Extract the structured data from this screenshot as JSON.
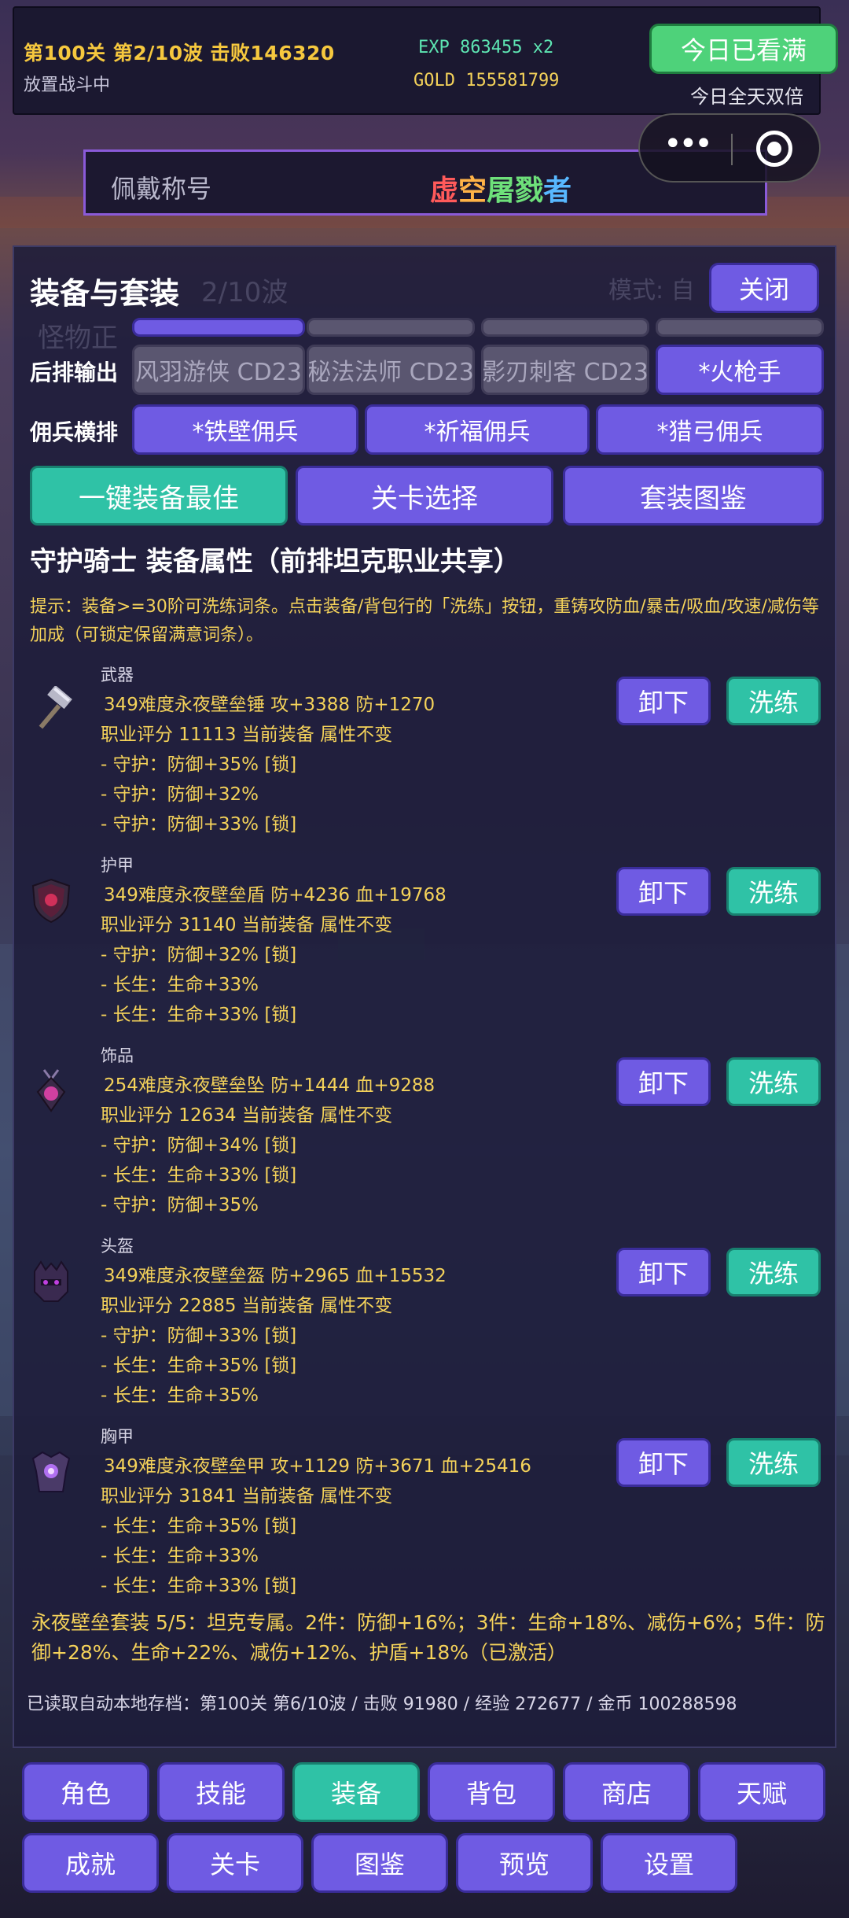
{
  "topbar": {
    "stage": "第100关 第2/10波  击败146320",
    "status": "放置战斗中",
    "exp": "EXP 863455 x2",
    "gold": "GOLD 155581799",
    "daily_button": "今日已看满",
    "daily_sub": "今日全天双倍"
  },
  "title_banner": {
    "label": "佩戴称号",
    "value_chars": [
      "虚",
      "空",
      "屠戮",
      "者"
    ]
  },
  "panel": {
    "title": "装备与套装",
    "close": "关闭",
    "ghost_texts": [
      "2/10波",
      "模式: 自",
      "怪物正"
    ],
    "rows": [
      {
        "label": "后排输出",
        "chips": [
          "风羽游侠 CD23",
          "秘法法师 CD23",
          "影刃刺客 CD23",
          "*火枪手"
        ]
      },
      {
        "label": "佣兵横排",
        "chips": [
          "*铁壁佣兵",
          "*祈福佣兵",
          "*猎弓佣兵"
        ]
      }
    ],
    "actions": [
      "一键装备最佳",
      "关卡选择",
      "套装图鉴"
    ],
    "heading": "守护骑士 装备属性（前排坦克职业共享）",
    "tip": "提示：装备>=30阶可洗练词条。点击装备/背包行的「洗练」按钮，重铸攻防血/暴击/吸血/攻速/减伤等加成（可锁定保留满意词条）。",
    "unload": "卸下",
    "refine": "洗练",
    "items": [
      {
        "category": "武器",
        "icon": "hammer-icon",
        "name": "349难度永夜壁垒锤  攻+3388 防+1270",
        "score": "职业评分 11113  当前装备  属性不变",
        "affixes": [
          "- 守护：防御+35% [锁]",
          "- 守护：防御+32%",
          "- 守护：防御+33% [锁]"
        ]
      },
      {
        "category": "护甲",
        "icon": "shield-icon",
        "name": "349难度永夜壁垒盾  防+4236 血+19768",
        "score": "职业评分 31140  当前装备  属性不变",
        "affixes": [
          "- 守护：防御+32% [锁]",
          "- 长生：生命+33%",
          "- 长生：生命+33% [锁]"
        ]
      },
      {
        "category": "饰品",
        "icon": "pendant-icon",
        "name": "254难度永夜壁垒坠  防+1444 血+9288",
        "score": "职业评分 12634  当前装备  属性不变",
        "affixes": [
          "- 守护：防御+34% [锁]",
          "- 长生：生命+33% [锁]",
          "- 守护：防御+35%"
        ]
      },
      {
        "category": "头盔",
        "icon": "helmet-icon",
        "name": "349难度永夜壁垒盔  防+2965 血+15532",
        "score": "职业评分 22885  当前装备  属性不变",
        "affixes": [
          "- 守护：防御+33% [锁]",
          "- 长生：生命+35% [锁]",
          "- 长生：生命+35%"
        ]
      },
      {
        "category": "胸甲",
        "icon": "chest-armor-icon",
        "name": "349难度永夜壁垒甲  攻+1129 防+3671 血+25416",
        "score": "职业评分 31841  当前装备  属性不变",
        "affixes": [
          "- 长生：生命+35% [锁]",
          "- 长生：生命+33%",
          "- 长生：生命+33% [锁]"
        ]
      }
    ],
    "set_info": "永夜壁垒套装 5/5：坦克专属。2件：防御+16%；3件：生命+18%、减伤+6%；5件：防御+28%、生命+22%、减伤+12%、护盾+18%（已激活）",
    "save_info": "已读取自动本地存档：第100关 第6/10波 / 击败 91980 / 经验 272677 / 金币 100288598"
  },
  "nav": {
    "row1": [
      "角色",
      "技能",
      "装备",
      "背包",
      "商店",
      "天赋"
    ],
    "row2": [
      "成就",
      "关卡",
      "图鉴",
      "预览",
      "设置"
    ],
    "active": "装备"
  }
}
